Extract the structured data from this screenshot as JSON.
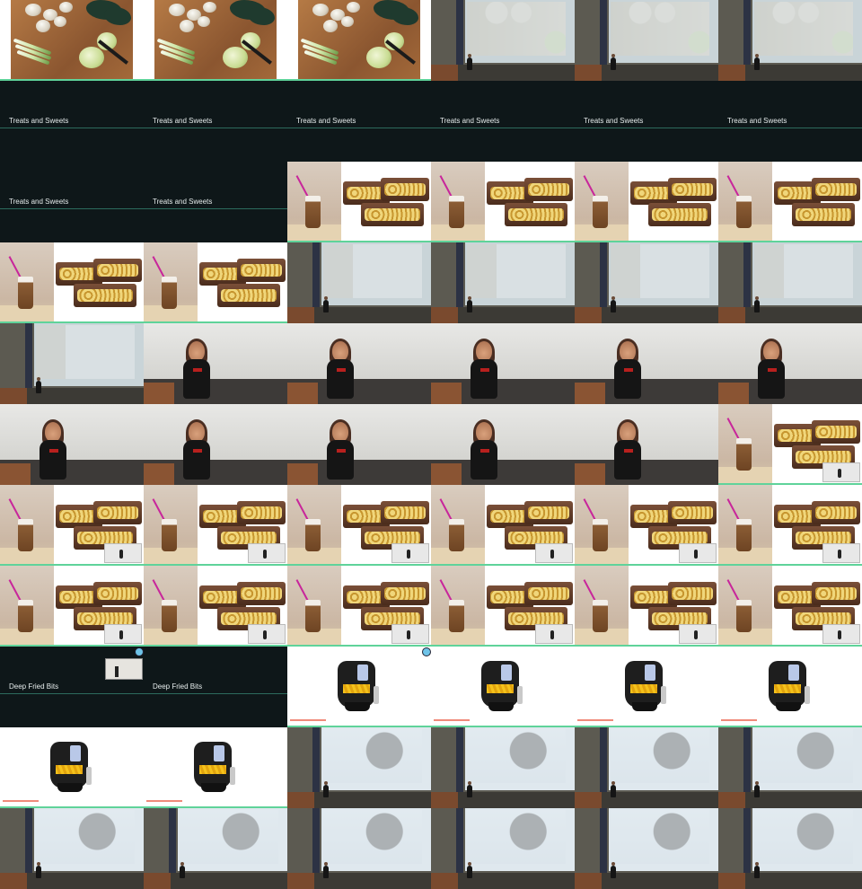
{
  "sections": {
    "treats_caption": "Treats and Sweets",
    "fried_caption": "Deep Fried Bits"
  },
  "tiles": [
    "veg",
    "veg",
    "veg",
    "hall-veg",
    "hall-veg",
    "hall-veg",
    "dark-treats",
    "dark-treats",
    "dark-treats",
    "dark-treats",
    "dark-treats",
    "dark-treats",
    "dark-treats",
    "dark-treats",
    "dessert",
    "dessert",
    "dessert",
    "dessert",
    "dessert",
    "dessert",
    "hall-dessert",
    "hall-dessert",
    "hall-dessert",
    "hall-dessert",
    "hall-dessert",
    "speaker",
    "speaker",
    "speaker",
    "speaker",
    "speaker",
    "speaker",
    "speaker",
    "speaker",
    "speaker",
    "speaker",
    "dessert-mini",
    "dessert-mini",
    "dessert-mini",
    "dessert-mini",
    "dessert-mini",
    "dessert-mini",
    "dessert-mini",
    "dessert-mini",
    "dessert-mini",
    "dessert-mini",
    "dessert-mini",
    "dessert-mini",
    "dessert-mini",
    "dark-fried",
    "dark-fried",
    "fryer",
    "fryer",
    "fryer",
    "fryer",
    "fryer",
    "fryer",
    "hall-fryer",
    "hall-fryer",
    "hall-fryer",
    "hall-fryer",
    "hall-fryer",
    "hall-fryer",
    "hall-fryer",
    "hall-fryer",
    "hall-fryer",
    "hall-fryer"
  ],
  "colors": {
    "dark_bg": "#0e1719",
    "accent_line": "#5fd39a",
    "caption_text": "#e6ecec"
  }
}
